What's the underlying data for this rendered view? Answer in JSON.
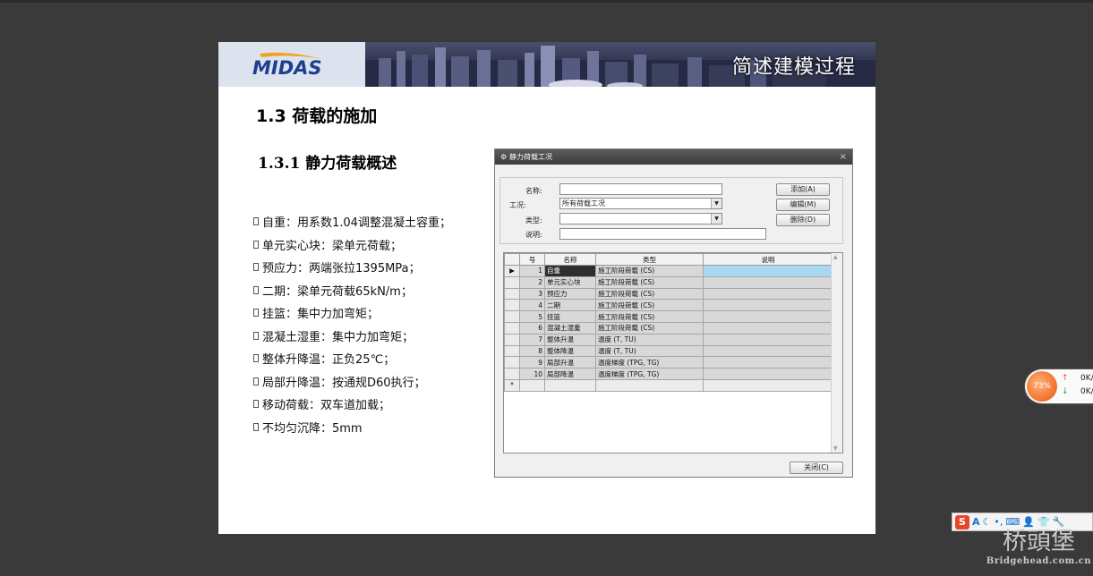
{
  "slide": {
    "header": {
      "logo_text": "MIDAS",
      "title": "简述建模过程"
    },
    "heading": "1.3 荷载的施加",
    "subheading": "1.3.1 静力荷载概述",
    "bullets": [
      "自重：用系数1.04调整混凝土容重；",
      "单元实心块：梁单元荷载；",
      "预应力：两端张拉1395MPa；",
      "二期：梁单元荷载65kN/m；",
      "挂篮：集中力加弯矩；",
      "混凝土湿重：集中力加弯矩；",
      "整体升降温：正负25℃；",
      "局部升降温：按通规D60执行；",
      "移动荷载：双车道加载；",
      "不均匀沉降：5mm"
    ]
  },
  "dialog": {
    "title": "静力荷载工况",
    "close_glyph": "×",
    "form": {
      "name_label": "名称:",
      "case_label": "工况:",
      "case_value": "所有荷载工况",
      "type_label": "类型:",
      "type_value": "",
      "desc_label": "说明:",
      "name_value": "",
      "desc_value": ""
    },
    "buttons": {
      "add": "添加(A)",
      "edit": "编辑(M)",
      "delete": "删除(D)",
      "close": "关闭(C)"
    },
    "table": {
      "columns": [
        "号",
        "名称",
        "类型",
        "说明"
      ],
      "rows": [
        {
          "no": "1",
          "name": "自重",
          "type": "施工阶段荷载 (CS)",
          "desc": ""
        },
        {
          "no": "2",
          "name": "单元实心块",
          "type": "施工阶段荷载 (CS)",
          "desc": ""
        },
        {
          "no": "3",
          "name": "预应力",
          "type": "施工阶段荷载 (CS)",
          "desc": ""
        },
        {
          "no": "4",
          "name": "二期",
          "type": "施工阶段荷载 (CS)",
          "desc": ""
        },
        {
          "no": "5",
          "name": "挂篮",
          "type": "施工阶段荷载 (CS)",
          "desc": ""
        },
        {
          "no": "6",
          "name": "混凝土湿重",
          "type": "施工阶段荷载 (CS)",
          "desc": ""
        },
        {
          "no": "7",
          "name": "整体升温",
          "type": "温度 (T, TU)",
          "desc": ""
        },
        {
          "no": "8",
          "name": "整体降温",
          "type": "温度 (T, TU)",
          "desc": ""
        },
        {
          "no": "9",
          "name": "局部升温",
          "type": "温度梯度 (TPG, TG)",
          "desc": ""
        },
        {
          "no": "10",
          "name": "局部降温",
          "type": "温度梯度 (TPG, TG)",
          "desc": ""
        }
      ],
      "current_marker": "▶",
      "new_row_marker": "*"
    }
  },
  "speed_widget": {
    "percent": "73%",
    "up_arrow": "↑",
    "down_arrow": "↓",
    "up_value": "0K/",
    "down_value": "0K/"
  },
  "ime_toolbar": {
    "logo": "S",
    "mode": "A",
    "icons": [
      "moon-icon",
      "punctuation-icon",
      "keyboard-icon",
      "user-icon",
      "shirt-icon",
      "wrench-icon"
    ]
  },
  "watermark": {
    "line1": "桥頭堡",
    "line2": "Bridgehead.com.cn"
  },
  "colors": {
    "background": "#3a3a3a",
    "selection": "#a8d8f0",
    "speed_orange": "#f0712a"
  }
}
